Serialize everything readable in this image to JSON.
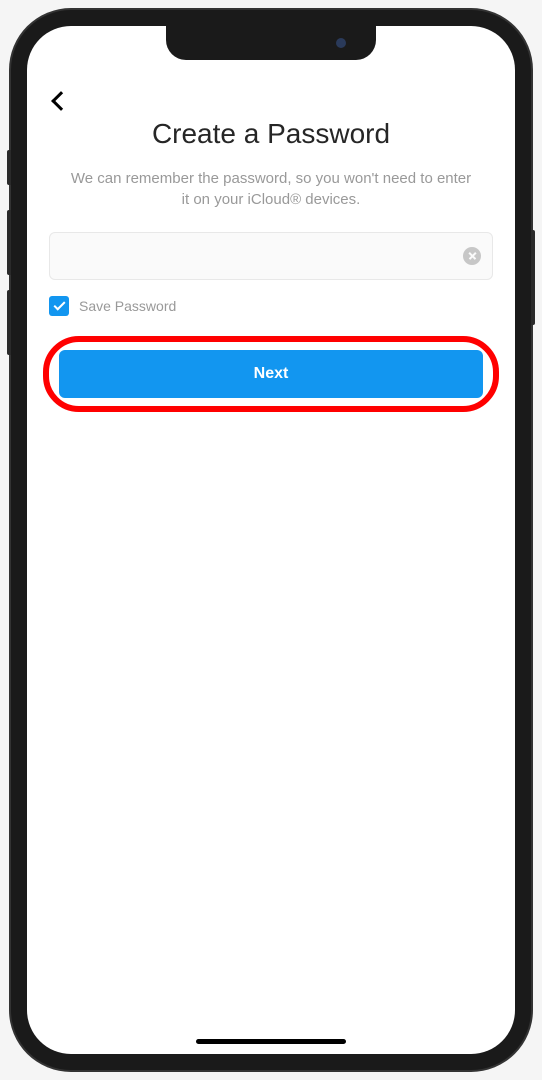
{
  "header": {
    "title": "Create a Password",
    "subtitle": "We can remember the password, so you won't need to enter it on your iCloud® devices."
  },
  "form": {
    "password_value": "",
    "save_password_checked": true,
    "save_password_label": "Save Password",
    "next_button_label": "Next"
  },
  "icons": {
    "back": "chevron-left",
    "clear": "close-circle",
    "check": "checkmark"
  },
  "annotation": {
    "highlight": "next-button"
  }
}
